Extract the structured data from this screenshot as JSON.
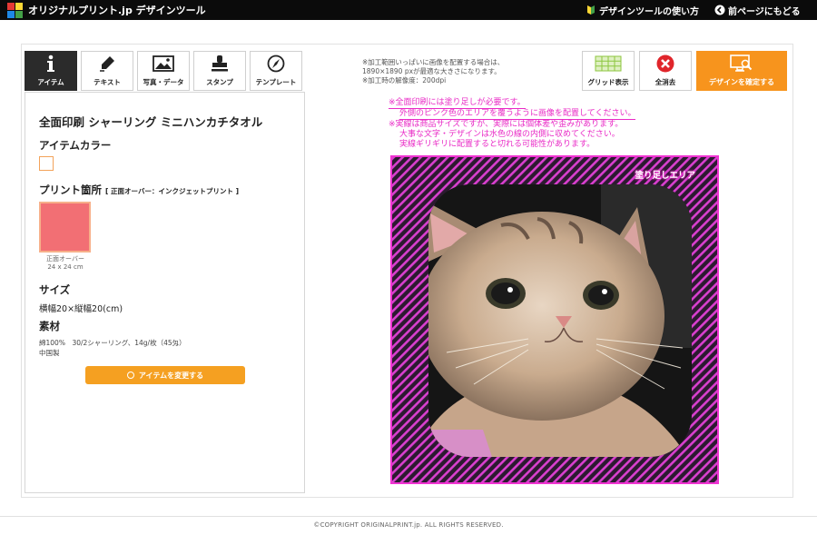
{
  "header": {
    "logo_text": "オリジナルプリント.jp デザインツール",
    "howto_label": "デザインツールの使い方",
    "back_label": "前ページにもどる"
  },
  "tabs": [
    {
      "label": "アイテム",
      "icon": "info-icon",
      "active": true
    },
    {
      "label": "テキスト",
      "icon": "pen-icon",
      "active": false
    },
    {
      "label": "写真・データ",
      "icon": "image-icon",
      "active": false
    },
    {
      "label": "スタンプ",
      "icon": "stamp-icon",
      "active": false
    },
    {
      "label": "テンプレート",
      "icon": "compass-icon",
      "active": false
    }
  ],
  "item": {
    "title": "全面印刷 シャーリング ミニハンカチタオル",
    "color_heading": "アイテムカラー",
    "print_heading": "プリント箇所",
    "print_note": "[ 正面オーバー：インクジェットプリント ]",
    "thumb_caption_1": "正面オーバー",
    "thumb_caption_2": "24 x 24 cm",
    "size_heading": "サイズ",
    "size_value": "横幅20×縦幅20(cm)",
    "material_heading": "素材",
    "material_line_1": "綿100%　30/2シャーリング、14g/枚（45匁）",
    "material_line_2": "中国製",
    "change_button": "アイテムを変更する"
  },
  "info": {
    "line1": "※加工範囲いっぱいに画像を配置する場合は、",
    "line2": "1890×1890 pxが最適な大きさになります。",
    "line3": "※加工時の解像度：200dpi"
  },
  "toolbar": {
    "grid_label": "グリッド表示",
    "clear_label": "全消去",
    "confirm_label": "デザインを確定する"
  },
  "warnings": {
    "line1": "※全面印刷には塗り足しが必要です。",
    "line2": "外側のピンク色のエリアを覆うように画像を配置してください。",
    "line3": "※実線は商品サイズですが、実際には個体差や歪みがあります。",
    "line4": "大事な文字・デザインは水色の線の内側に収めてください。",
    "line5": "実線ギリギリに配置すると切れる可能性があります。"
  },
  "canvas": {
    "bleed_label": "塗り足しエリア"
  },
  "footer": {
    "copyright": "©COPYRIGHT ORIGINALPRINT.jp. ALL RIGHTS RESERVED."
  },
  "colors": {
    "accent_orange": "#f7941d",
    "bleed_pink": "#f033d2",
    "header_bg": "#0b0b0b"
  }
}
